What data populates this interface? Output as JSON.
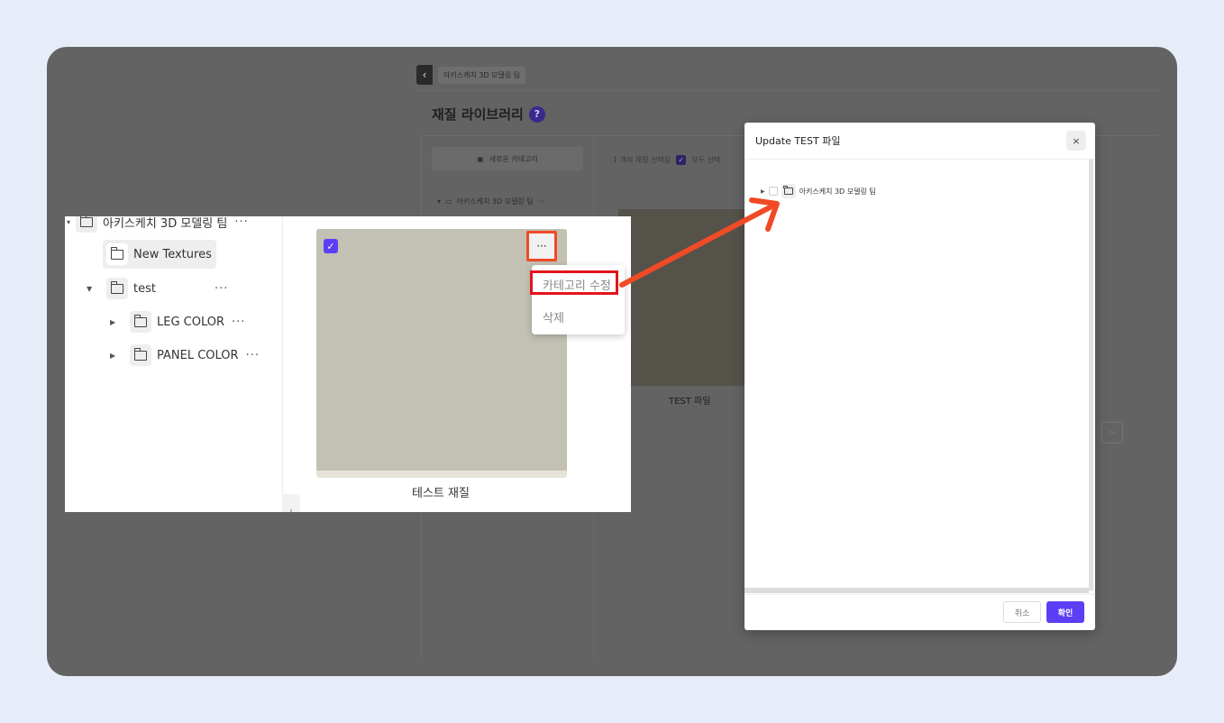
{
  "background_app": {
    "back_icon": "chevron-left-icon",
    "team_name": "아키스케치 3D 모델링 팀",
    "page_title": "재질 라이브러리",
    "help_icon": "question-icon",
    "help_glyph": "?",
    "new_category_label": "새로운 카테고리",
    "tree_root_label": "아키스케치 3D 모델링 팀",
    "selection_info": "1 개의 재질 선택됨",
    "select_all_label": "모두 선택",
    "card_label": "TEST 파일",
    "pager_icon": "chevron-right-icon",
    "pager_glyph": ">"
  },
  "inset": {
    "tree": {
      "root": {
        "label": "아키스케치 3D 모델링 팀",
        "more": "···"
      },
      "items": [
        {
          "label": "New Textures",
          "selected": true
        },
        {
          "label": "test",
          "more": "···",
          "expanded": true
        },
        {
          "label": "LEG COLOR",
          "more": "···"
        },
        {
          "label": "PANEL COLOR",
          "more": "···"
        }
      ]
    },
    "material_card": {
      "label": "테스트 재질",
      "swatch_color": "#c3c0b4",
      "checked": true,
      "more": "···"
    },
    "context_menu": {
      "items": [
        "카테고리 수정",
        "삭제"
      ]
    },
    "highlight_color": "#e4141b",
    "arrow_color": "#f04a26"
  },
  "modal": {
    "title": "Update TEST 파일",
    "close_glyph": "×",
    "tree_item": "아키스케치 3D 모델링 팀",
    "cancel_label": "취소",
    "confirm_label": "확인",
    "accent_color": "#5b3ff5"
  }
}
